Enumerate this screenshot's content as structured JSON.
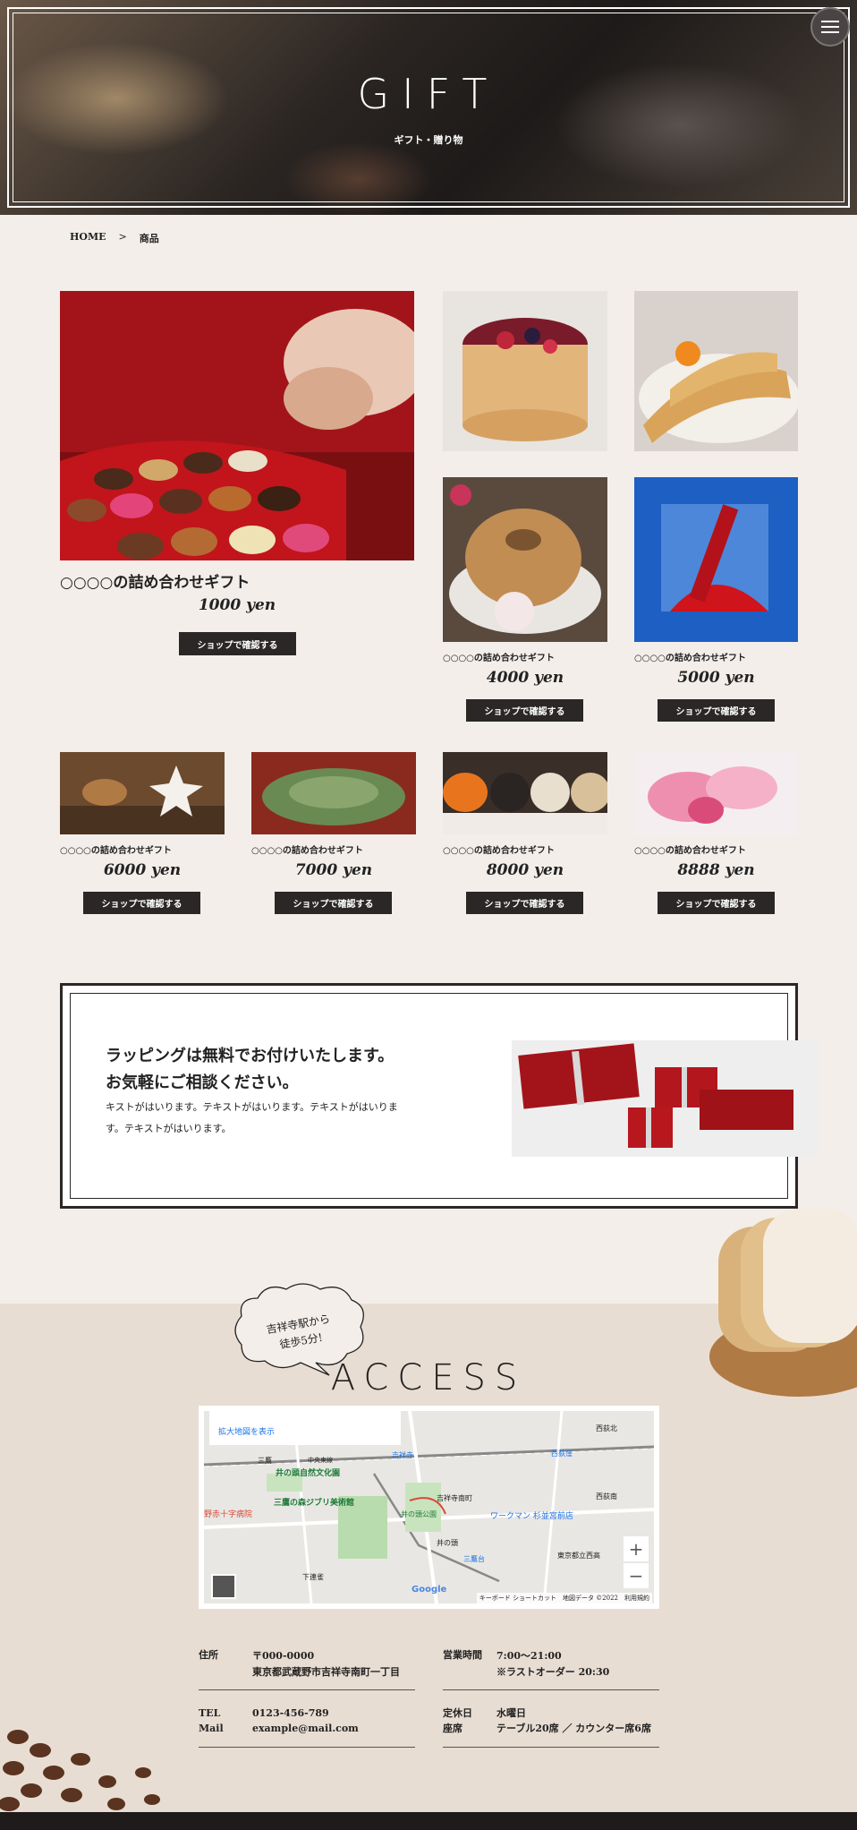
{
  "hero": {
    "title": "GIFT",
    "subtitle": "ギフト・贈り物"
  },
  "breadcrumb": {
    "home": "HOME",
    "sep": ">",
    "current": "商品"
  },
  "featured": {
    "name": "○○○○の詰め合わせギフト",
    "price": "1000 yen",
    "button": "ショップで確認する"
  },
  "products_top": [
    {
      "price": "",
      "name": "",
      "button": ""
    },
    {
      "price": "",
      "name": "",
      "button": ""
    },
    {
      "name": "○○○○の詰め合わせギフト",
      "price": "4000 yen",
      "button": "ショップで確認する"
    },
    {
      "name": "○○○○の詰め合わせギフト",
      "price": "5000 yen",
      "button": "ショップで確認する"
    }
  ],
  "products_bottom": [
    {
      "name": "○○○○の詰め合わせギフト",
      "price": "6000 yen",
      "button": "ショップで確認する"
    },
    {
      "name": "○○○○の詰め合わせギフト",
      "price": "7000 yen",
      "button": "ショップで確認する"
    },
    {
      "name": "○○○○の詰め合わせギフト",
      "price": "8000 yen",
      "button": "ショップで確認する"
    },
    {
      "name": "○○○○の詰め合わせギフト",
      "price": "8888 yen",
      "button": "ショップで確認する"
    }
  ],
  "wrapping": {
    "heading_line1": "ラッピングは無料でお付けいたします。",
    "heading_line2": "お気軽にご相談ください。",
    "text": "キストがはいります。テキストがはいります。テキストがはいります。テキストがはいります。"
  },
  "access": {
    "bubble_line1": "吉祥寺駅から",
    "bubble_line2": "徒歩5分!",
    "title": "ACCESS",
    "map_link": "拡大地図を表示",
    "map_labels": [
      "西荻北",
      "西荻窪",
      "中央東線",
      "吉祥寺",
      "井の頭自然文化園",
      "三鷹の森ジブリ美術館",
      "井の頭公園",
      "吉祥寺南町",
      "ワークマン 杉並宮前店",
      "西荻南",
      "東京都立西高",
      "三鷹台",
      "下連雀",
      "井の頭",
      "野赤十字病院",
      "三鷹"
    ],
    "map_footer": "キーボード ショートカット　地図データ ©2022　利用規約",
    "google": "Google",
    "zoom_in": "+",
    "zoom_out": "−",
    "address_label": "住所",
    "address_line1": "〒000-0000",
    "address_line2": "東京都武蔵野市吉祥寺南町一丁目",
    "hours_label": "営業時間",
    "hours_line1": "7:00～21:00",
    "hours_line2": "※ラストオーダー 20:30",
    "tel_label": "TEL",
    "tel": "0123-456-789",
    "mail_label": "Mail",
    "mail": "example@mail.com",
    "holiday_label": "定休日",
    "holiday": "水曜日",
    "seats_label": "座席",
    "seats": "テーブル20席 ／ カウンター席6席"
  },
  "colors": {
    "background": "#f3eeea",
    "dark": "#2a2726",
    "access_bg": "#e8ddd2"
  }
}
